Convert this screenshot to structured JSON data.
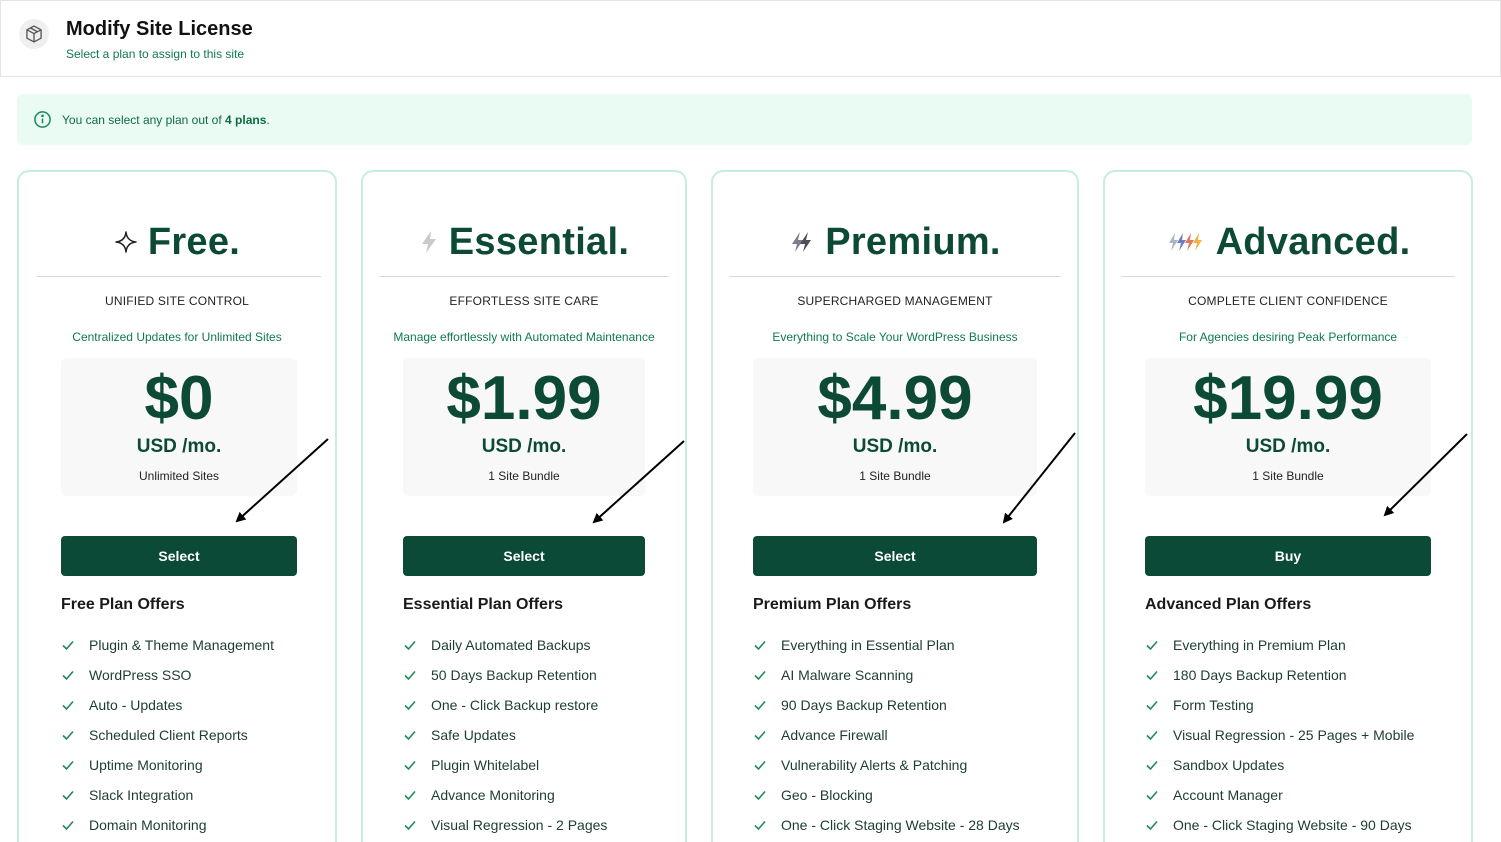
{
  "header": {
    "title": "Modify Site License",
    "subtitle": "Select a plan to assign to this site",
    "icon": "box-icon"
  },
  "notice": {
    "prefix": "You can select any plan out of ",
    "count": "4 plans",
    "suffix": ".",
    "icon": "info-circle-icon"
  },
  "colors": {
    "brand_dark": "#0b4a36",
    "brand_text": "#0f7a4f",
    "card_border": "#c7ecd9",
    "notice_bg": "#eafbf3"
  },
  "plans": [
    {
      "name": "Free.",
      "icon": "sparkle-icon",
      "tagline": "UNIFIED SITE CONTROL",
      "subtag": "Centralized Updates for Unlimited Sites",
      "price": "$0",
      "unit": "USD /mo.",
      "bundle": "Unlimited Sites",
      "button": "Select",
      "offers_title": "Free Plan Offers",
      "features": [
        "Plugin & Theme Management",
        "WordPress SSO",
        "Auto - Updates",
        "Scheduled Client Reports",
        "Uptime Monitoring",
        "Slack Integration",
        "Domain Monitoring"
      ]
    },
    {
      "name": "Essential.",
      "icon": "lightning-icon",
      "tagline": "EFFORTLESS SITE CARE",
      "subtag": "Manage effortlessly with Automated Maintenance",
      "price": "$1.99",
      "unit": "USD /mo.",
      "bundle": "1 Site Bundle",
      "button": "Select",
      "offers_title": "Essential Plan Offers",
      "features": [
        "Daily Automated Backups",
        "50 Days Backup Retention",
        "One - Click Backup restore",
        "Safe Updates",
        "Plugin Whitelabel",
        "Advance Monitoring",
        "Visual Regression - 2 Pages"
      ]
    },
    {
      "name": "Premium.",
      "icon": "double-lightning-icon",
      "tagline": "SUPERCHARGED MANAGEMENT",
      "subtag": "Everything to Scale Your WordPress Business",
      "price": "$4.99",
      "unit": "USD /mo.",
      "bundle": "1 Site Bundle",
      "button": "Select",
      "offers_title": "Premium Plan Offers",
      "features": [
        "Everything in Essential Plan",
        "AI Malware Scanning",
        "90 Days Backup Retention",
        "Advance Firewall",
        "Vulnerability Alerts & Patching",
        "Geo - Blocking",
        "One - Click Staging Website - 28 Days"
      ]
    },
    {
      "name": "Advanced.",
      "icon": "multi-lightning-icon",
      "tagline": "COMPLETE CLIENT CONFIDENCE",
      "subtag": "For Agencies desiring Peak Performance",
      "price": "$19.99",
      "unit": "USD /mo.",
      "bundle": "1 Site Bundle",
      "button": "Buy",
      "offers_title": "Advanced Plan Offers",
      "features": [
        "Everything in Premium Plan",
        "180 Days Backup Retention",
        "Form Testing",
        "Visual Regression - 25 Pages + Mobile",
        "Sandbox Updates",
        "Account Manager",
        "One - Click Staging Website - 90 Days"
      ]
    }
  ]
}
